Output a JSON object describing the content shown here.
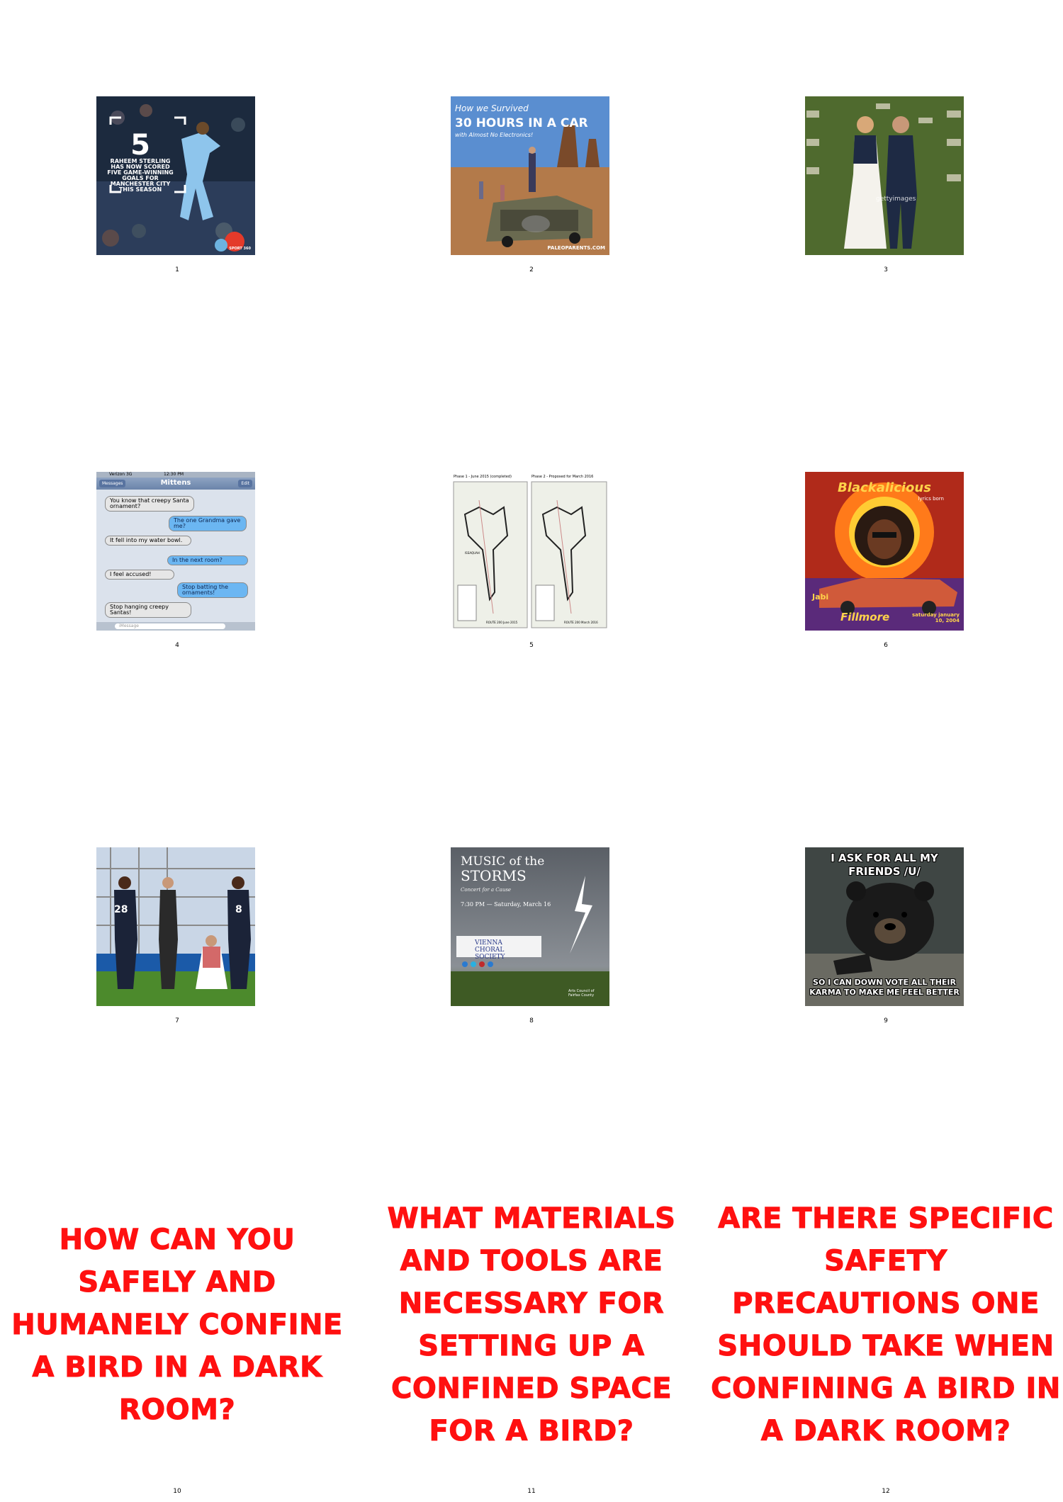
{
  "cells": [
    {
      "number": "1",
      "overlay_big": "5",
      "overlay_text": "RAHEEM STERLING HAS NOW SCORED FIVE GAME-WINNING GOALS FOR MANCHESTER CITY THIS SEASON",
      "badge": "SPORT 360"
    },
    {
      "number": "2",
      "title_script": "How we Survived",
      "title_big": "30 HOURS IN A CAR",
      "title_script2": "with Almost No Electronics!",
      "credit": "PALEOPARENTS.COM"
    },
    {
      "number": "3",
      "watermark": "gettyimages"
    },
    {
      "number": "4",
      "status_carrier": "Verizon 3G",
      "status_time": "12:30 PM",
      "nav_back": "Messages",
      "nav_title": "Mittens",
      "nav_edit": "Edit",
      "messages": [
        {
          "side": "l",
          "text": "You know that creepy Santa ornament?"
        },
        {
          "side": "r",
          "text": "The one Grandma gave me?"
        },
        {
          "side": "l",
          "text": "It fell into my water bowl."
        },
        {
          "side": "r",
          "text": "In the next room?"
        },
        {
          "side": "l",
          "text": "I feel accused!"
        },
        {
          "side": "r",
          "text": "Stop batting the ornaments!"
        },
        {
          "side": "l",
          "text": "Stop hanging creepy Santas!"
        }
      ],
      "input_placeholder": "iMessage"
    },
    {
      "number": "5",
      "map_left_title": "Phase 1 - June 2015 (completed)",
      "map_right_title": "Phase 2 - Proposed for March 2016",
      "map_left_footer": "ROUTE 200 June 2015",
      "map_right_footer": "ROUTE 200 March 2016",
      "map_label": "ISSAQUAH"
    },
    {
      "number": "6",
      "title": "Blackalicious",
      "subtitle": "lyrics born",
      "venue": "Fillmore",
      "date": "saturday january 10, 2004",
      "act": "Jabi"
    },
    {
      "number": "7",
      "player_left": "28",
      "player_right": "8"
    },
    {
      "number": "8",
      "title_line1": "MUSIC of the",
      "title_line2": "STORMS",
      "subtitle": "Concert for a Cause",
      "date_line": "7:30 PM — Saturday, March 16",
      "org": "VIENNA CHORAL SOCIETY",
      "footer": "Arts Council of Fairfax County"
    },
    {
      "number": "9",
      "top_text": "I ASK FOR ALL MY FRIENDS /U/",
      "bottom_text": "SO I CAN DOWN VOTE ALL THEIR KARMA TO MAKE ME FEEL BETTER"
    },
    {
      "number": "10",
      "question": "HOW CAN YOU SAFELY AND HUMANELY CONFINE A BIRD IN A DARK ROOM?"
    },
    {
      "number": "11",
      "question": "WHAT MATERIALS AND TOOLS ARE NECESSARY FOR SETTING UP A CONFINED SPACE FOR A BIRD?"
    },
    {
      "number": "12",
      "question": "ARE THERE SPECIFIC SAFETY PRECAUTIONS ONE SHOULD TAKE WHEN CONFINING A BIRD IN A DARK ROOM?"
    }
  ],
  "colors": {
    "question_text": "#ff1010",
    "background": "#ffffff"
  }
}
